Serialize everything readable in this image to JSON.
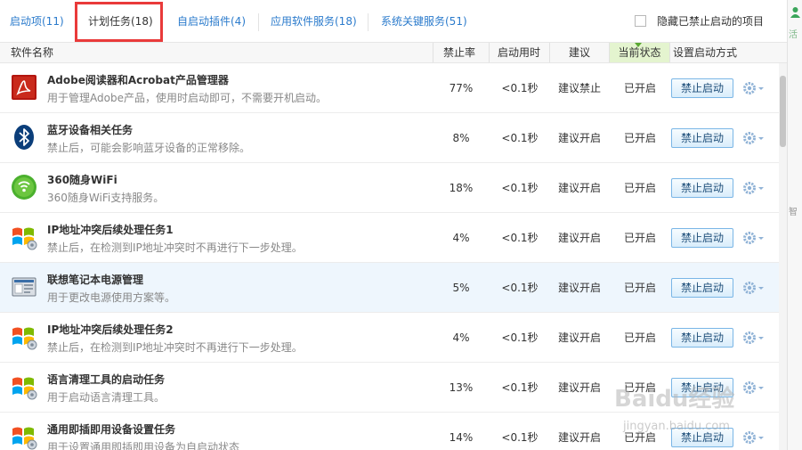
{
  "tabs": [
    {
      "label": "启动项(11)"
    },
    {
      "label": "计划任务(18)"
    },
    {
      "label": "自启动插件(4)"
    },
    {
      "label": "应用软件服务(18)"
    },
    {
      "label": "系统关键服务(51)"
    }
  ],
  "hide_disabled": {
    "label": "隐藏已禁止启动的项目",
    "checked": false
  },
  "columns": {
    "name": "软件名称",
    "rate": "禁止率",
    "time": "启动用时",
    "advice": "建议",
    "state": "当前状态",
    "mode": "设置启动方式"
  },
  "rows": [
    {
      "title": "Adobe阅读器和Acrobat产品管理器",
      "desc": "用于管理Adobe产品，使用时启动即可，不需要开机启动。",
      "rate": "77%",
      "time": "<0.1秒",
      "advice": "建议禁止",
      "state": "已开启",
      "action": "禁止启动",
      "icon": "adobe-acrobat-icon"
    },
    {
      "title": "蓝牙设备相关任务",
      "desc": "禁止后，可能会影响蓝牙设备的正常移除。",
      "rate": "8%",
      "time": "<0.1秒",
      "advice": "建议开启",
      "state": "已开启",
      "action": "禁止启动",
      "icon": "bluetooth-icon"
    },
    {
      "title": "360随身WiFi",
      "desc": "360随身WiFi支持服务。",
      "rate": "18%",
      "time": "<0.1秒",
      "advice": "建议开启",
      "state": "已开启",
      "action": "禁止启动",
      "icon": "wifi-icon"
    },
    {
      "title": "IP地址冲突后续处理任务1",
      "desc": "禁止后，在检测到IP地址冲突时不再进行下一步处理。",
      "rate": "4%",
      "time": "<0.1秒",
      "advice": "建议开启",
      "state": "已开启",
      "action": "禁止启动",
      "icon": "windows-icon"
    },
    {
      "title": "联想笔记本电源管理",
      "desc": "用于更改电源使用方案等。",
      "rate": "5%",
      "time": "<0.1秒",
      "advice": "建议开启",
      "state": "已开启",
      "action": "禁止启动",
      "icon": "power-manager-icon"
    },
    {
      "title": "IP地址冲突后续处理任务2",
      "desc": "禁止后，在检测到IP地址冲突时不再进行下一步处理。",
      "rate": "4%",
      "time": "<0.1秒",
      "advice": "建议开启",
      "state": "已开启",
      "action": "禁止启动",
      "icon": "windows-icon"
    },
    {
      "title": "语言清理工具的启动任务",
      "desc": "用于启动语言清理工具。",
      "rate": "13%",
      "time": "<0.1秒",
      "advice": "建议开启",
      "state": "已开启",
      "action": "禁止启动",
      "icon": "windows-icon"
    },
    {
      "title": "通用即插即用设备设置任务",
      "desc": "用于设置通用即插即用设备为自启动状态",
      "rate": "14%",
      "time": "<0.1秒",
      "advice": "建议开启",
      "state": "已开启",
      "action": "禁止启动",
      "icon": "windows-icon"
    }
  ],
  "side_panel": {
    "text1": "活",
    "text2": "智"
  },
  "watermark": {
    "brand": "Baidu经验",
    "url": "jingyan.baidu.com"
  }
}
